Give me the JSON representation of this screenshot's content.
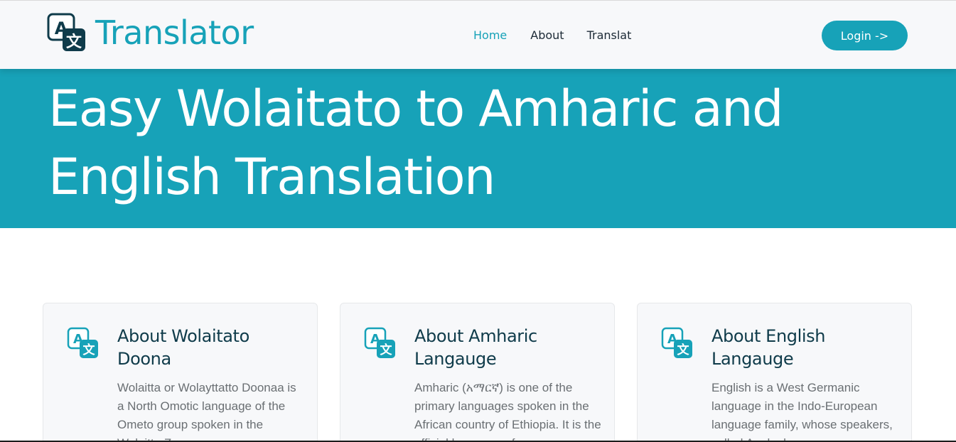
{
  "navbar": {
    "brand": "Translator",
    "links": [
      "Home",
      "About",
      "Translat"
    ],
    "login_label": "Login ->"
  },
  "hero": {
    "title": "Easy Wolaitato to Amharic and English Translation"
  },
  "cards": [
    {
      "title": "About Wolaitato Doona",
      "text": "Wolaitta or Wolayttatto Doonaa is a North Omotic language of the Ometo group spoken in the Wolaitta Z"
    },
    {
      "title": "About Amharic Langauge",
      "text": "Amharic (አማርኛ) is one of the primary languages spoken in the African country of Ethiopia. It is the official language of"
    },
    {
      "title": "About English Langauge",
      "text": "English is a West Germanic language in the Indo-European language family, whose speakers, called Anglophones"
    }
  ],
  "colors": {
    "accent": "#17a2b8",
    "dark": "#0f3b4a",
    "navbar_bg": "#f7f8fa"
  },
  "icons": [
    "translate-icon"
  ]
}
